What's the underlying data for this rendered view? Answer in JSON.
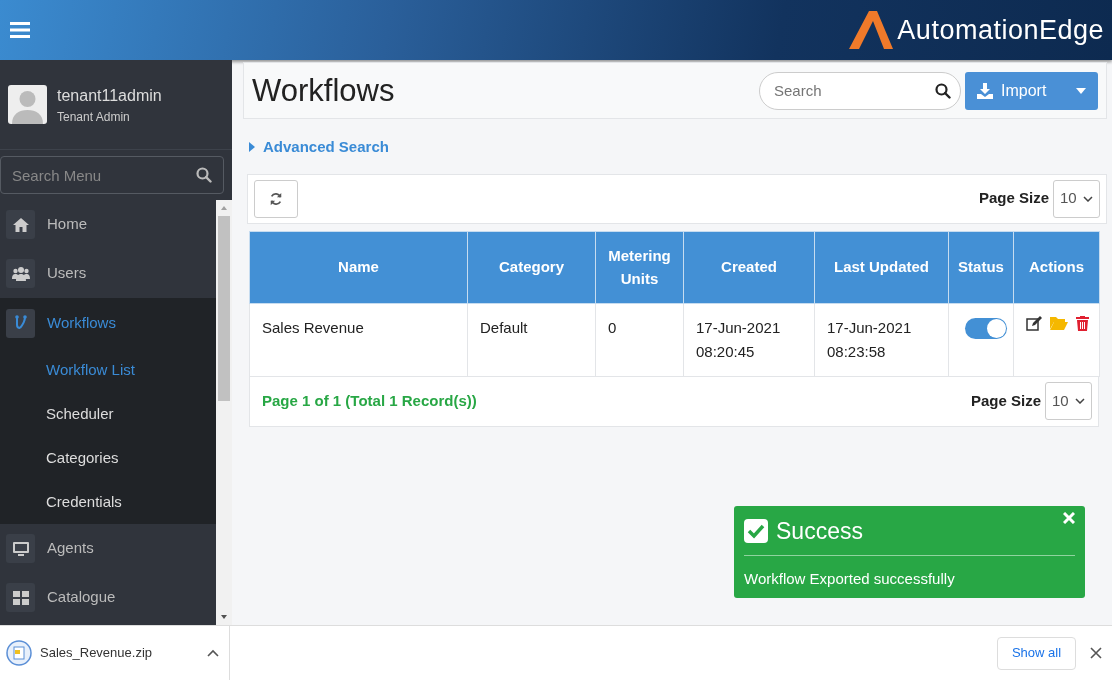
{
  "header": {
    "logo_text": "AutomationEdge"
  },
  "user": {
    "name": "tenant11admin",
    "role": "Tenant Admin"
  },
  "sidebar": {
    "search_placeholder": "Search Menu",
    "items": [
      {
        "label": "Home",
        "selected": false,
        "expanded": false
      },
      {
        "label": "Users",
        "selected": false,
        "expanded": false
      },
      {
        "label": "Workflows",
        "selected": true,
        "expanded": true,
        "children": [
          {
            "label": "Workflow List",
            "selected": true
          },
          {
            "label": "Scheduler",
            "selected": false
          },
          {
            "label": "Categories",
            "selected": false
          },
          {
            "label": "Credentials",
            "selected": false
          }
        ]
      },
      {
        "label": "Agents",
        "selected": false,
        "expanded": false
      },
      {
        "label": "Catalogue",
        "selected": false,
        "expanded": false
      }
    ]
  },
  "page": {
    "title": "Workflows",
    "search_placeholder": "Search",
    "import_button": "Import",
    "advanced_search": "Advanced Search",
    "page_size_label": "Page Size",
    "page_size": "10"
  },
  "table": {
    "columns": [
      "Name",
      "Category",
      "Metering Units",
      "Created",
      "Last Updated",
      "Status",
      "Actions"
    ],
    "rows": [
      {
        "name": "Sales Revenue",
        "category": "Default",
        "metering_units": "0",
        "created": "17-Jun-2021 08:20:45",
        "last_updated": "17-Jun-2021 08:23:58",
        "status_on": true
      }
    ]
  },
  "footer": {
    "pager": "Page 1 of 1 (Total 1 Record(s))",
    "page_size_label": "Page Size",
    "page_size": "10"
  },
  "toast": {
    "title": "Success",
    "message": "Workflow Exported successfully"
  },
  "download_bar": {
    "file": "Sales_Revenue.zip",
    "show_all": "Show all"
  }
}
